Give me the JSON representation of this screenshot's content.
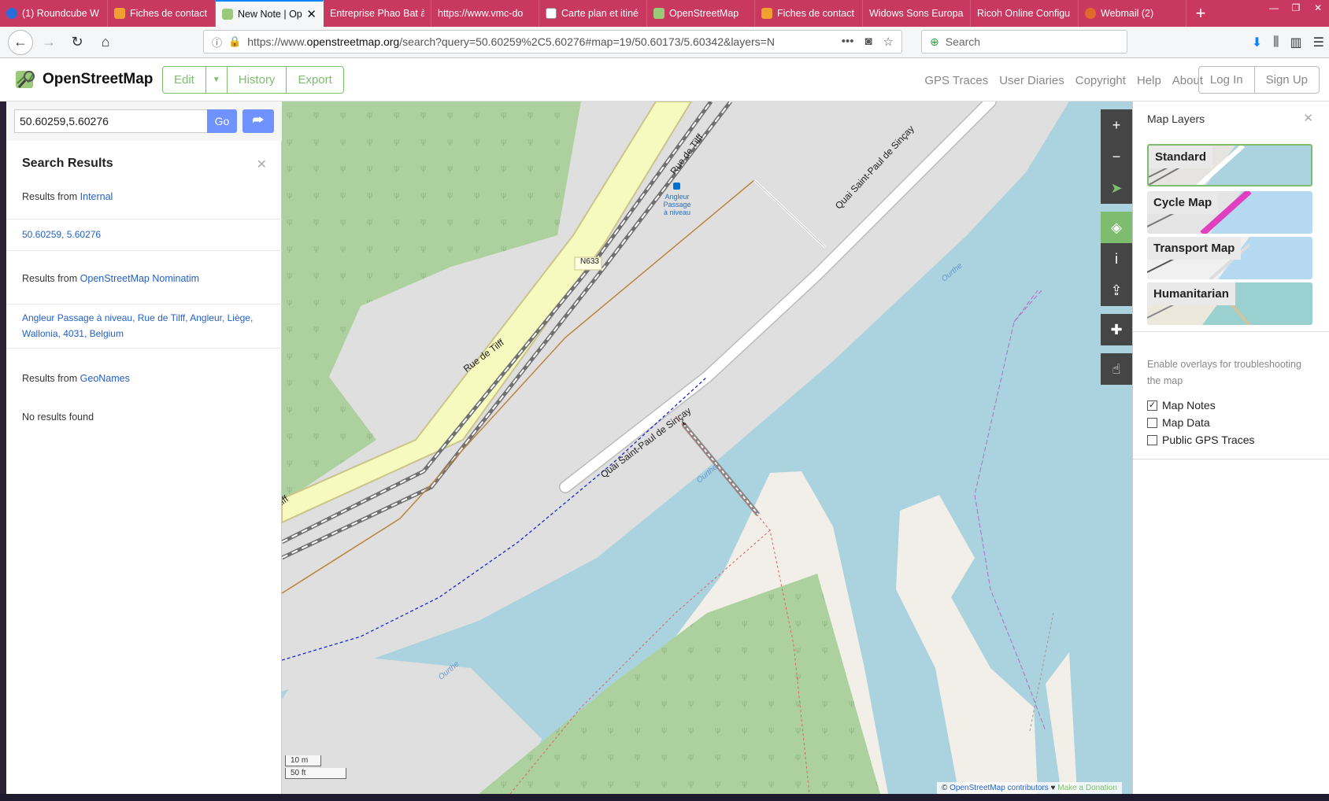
{
  "browser": {
    "tabs": [
      {
        "label": "(1) Roundcube W",
        "icon": "roundcube-icon",
        "active": false
      },
      {
        "label": "Fiches de contact",
        "icon": "joomla-icon",
        "active": false
      },
      {
        "label": "New Note | Op",
        "icon": "osm-icon",
        "active": true
      },
      {
        "label": "Entreprise Phao Bat à",
        "icon": "",
        "active": false
      },
      {
        "label": "https://www.vmc-do",
        "icon": "",
        "active": false
      },
      {
        "label": "Carte plan et itiné",
        "icon": "map-icon",
        "active": false
      },
      {
        "label": "OpenStreetMap",
        "icon": "osm-icon",
        "active": false
      },
      {
        "label": "Fiches de contact",
        "icon": "joomla-icon",
        "active": false
      },
      {
        "label": "Widows Sons Europa",
        "icon": "",
        "active": false
      },
      {
        "label": "Ricoh Online Configu",
        "icon": "",
        "active": false
      },
      {
        "label": "Webmail (2)",
        "icon": "webmail-icon",
        "active": false
      }
    ],
    "url_prefix": "https://www.",
    "url_domain": "openstreetmap.org",
    "url_rest": "/search?query=50.60259%2C5.60276#map=19/50.60173/5.60342&layers=N",
    "search_placeholder": "Search"
  },
  "osm": {
    "brand": "OpenStreetMap",
    "edit_label": "Edit",
    "history_label": "History",
    "export_label": "Export",
    "nav_links": [
      "GPS Traces",
      "User Diaries",
      "Copyright",
      "Help",
      "About"
    ],
    "login_label": "Log In",
    "signup_label": "Sign Up"
  },
  "sidebar": {
    "query": "50.60259,5.60276",
    "go_label": "Go",
    "title": "Search Results",
    "sections": [
      {
        "prefix": "Results from ",
        "source": "Internal"
      },
      {
        "prefix": "Results from ",
        "source": "OpenStreetMap Nominatim"
      },
      {
        "prefix": "Results from ",
        "source": "GeoNames"
      }
    ],
    "internal_result": "50.60259, 5.60276",
    "nominatim_result": "Angleur Passage à niveau, Rue de Tilff, Angleur, Liège, Wallonia, 4031, Belgium",
    "geonames_result": "No results found"
  },
  "map": {
    "labels": {
      "rue_de_tilff": "Rue de Tilff",
      "rue_de_tilff_cut": "ilff",
      "quai": "Quai Saint-Paul de Sinçay",
      "ourthe": "Ourthe",
      "n633": "N633",
      "angleur_1": "Angleur",
      "angleur_2": "Passage",
      "angleur_3": "à niveau"
    },
    "scale_m": "10 m",
    "scale_ft": "50 ft",
    "attribution_osm": "OpenStreetMap contributors",
    "attribution_donate": "Make a Donation",
    "colors": {
      "water": "#aad3df",
      "forest": "#add19e",
      "landuse": "#e0dfdf",
      "sand": "#f2efe9",
      "primary_road": "#f7fabf"
    }
  },
  "layers": {
    "title": "Map Layers",
    "items": [
      {
        "label": "Standard",
        "selected": true
      },
      {
        "label": "Cycle Map",
        "selected": false
      },
      {
        "label": "Transport Map",
        "selected": false
      },
      {
        "label": "Humanitarian",
        "selected": false
      }
    ],
    "overlay_hint": "Enable overlays for troubleshooting the map",
    "overlays": [
      {
        "label": "Map Notes",
        "checked": true
      },
      {
        "label": "Map Data",
        "checked": false
      },
      {
        "label": "Public GPS Traces",
        "checked": false
      }
    ]
  }
}
